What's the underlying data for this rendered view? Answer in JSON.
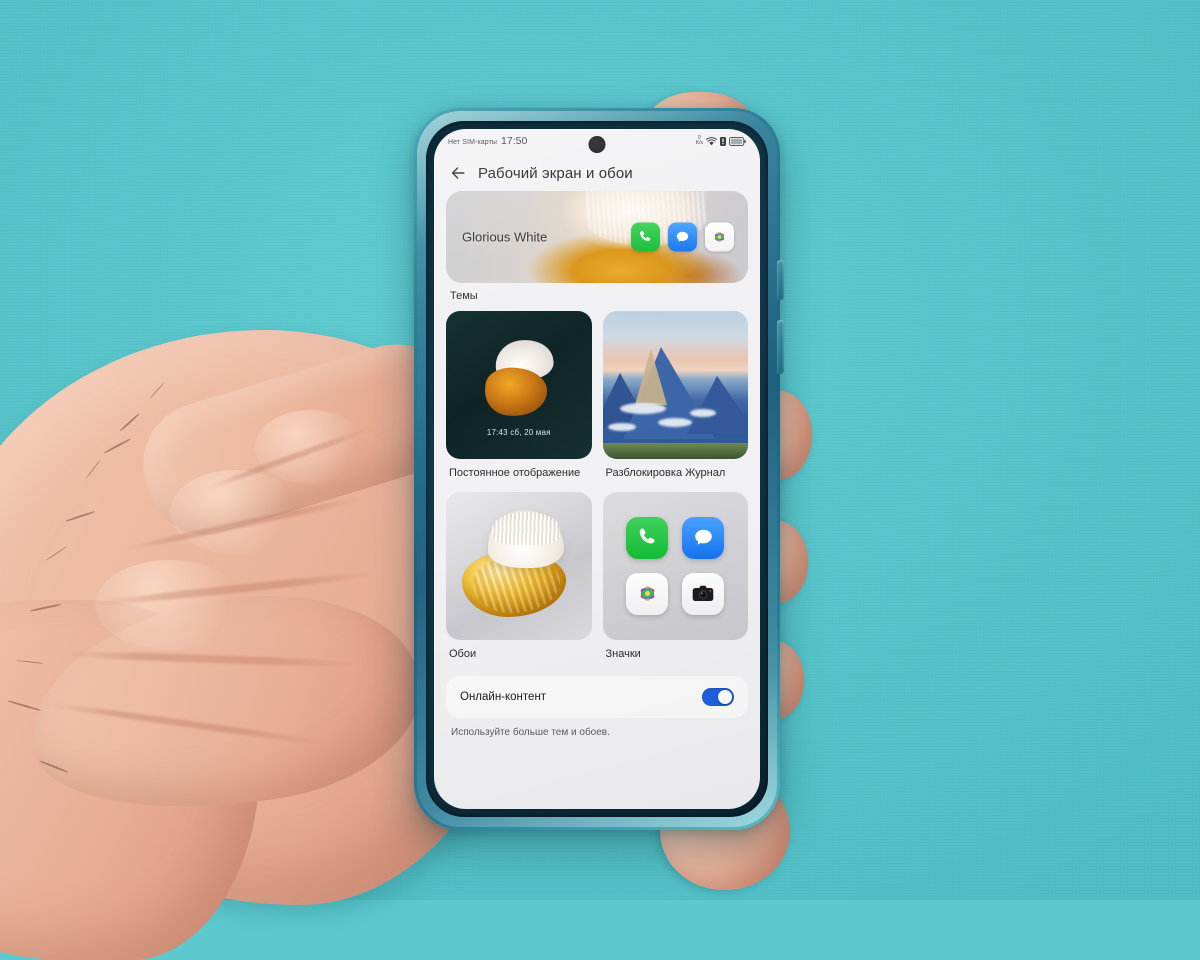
{
  "background": {
    "color": "#5cc9cf"
  },
  "phone": {
    "case_color": "#1d5f7e",
    "screen_bg": "#f1f1f3"
  },
  "statusbar": {
    "sim_text": "Нет SIM-карты",
    "clock": "17:50",
    "netspeed_value": "0",
    "netspeed_unit": "K/s",
    "icons": [
      "wifi-icon",
      "signal-icon",
      "battery-icon"
    ]
  },
  "header": {
    "back_icon": "back-arrow-icon",
    "title": "Рабочий экран и обои"
  },
  "theme_banner": {
    "name": "Glorious White",
    "icons": [
      "phone-icon",
      "messages-icon",
      "gallery-icon"
    ]
  },
  "labels": {
    "themes": "Темы",
    "always_on_display": "Постоянное отображение",
    "lock_screen": "Разблокировка Журнал",
    "wallpaper": "Обои",
    "app_icons": "Значки"
  },
  "aod_card": {
    "clock": "17:43 сб, 20 мая"
  },
  "icons_card": {
    "icons": [
      "phone-icon",
      "messages-icon",
      "gallery-icon",
      "camera-icon"
    ]
  },
  "online_content": {
    "label": "Онлайн-контент",
    "enabled": true,
    "accent_color": "#1f5fe0"
  },
  "footnote": "Используйте больше тем и обоев."
}
